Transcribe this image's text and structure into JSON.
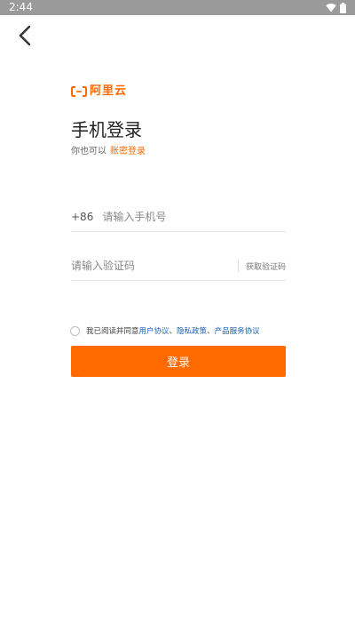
{
  "status_bar": {
    "time": "2:44",
    "icons": [
      "wifi-icon",
      "battery-icon"
    ]
  },
  "nav": {
    "back_icon": "chevron-left-icon"
  },
  "brand": {
    "logo_text": "阿里云",
    "logo_icon": "aliyun-bracket-icon",
    "accent_color": "#ff6a00"
  },
  "header": {
    "title": "手机登录",
    "alt_prefix": "你也可以",
    "alt_link": "账密登录"
  },
  "form": {
    "country_code": "+86",
    "phone_placeholder": "请输入手机号",
    "phone_value": "",
    "code_placeholder": "请输入验证码",
    "code_value": "",
    "get_code_label": "获取验证码"
  },
  "agreement": {
    "prefix": "我已阅读并同意",
    "links": [
      "用户协议",
      "隐私政策",
      "产品服务协议"
    ],
    "separator": "、",
    "link_color": "#1a5fb4"
  },
  "actions": {
    "login_label": "登录"
  }
}
